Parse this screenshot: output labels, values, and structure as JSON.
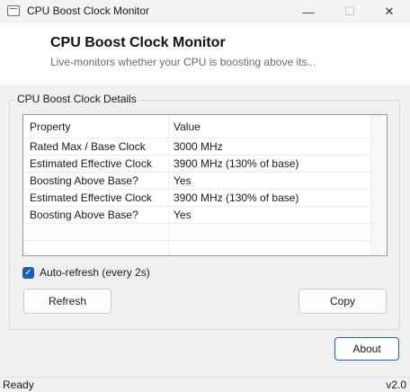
{
  "window": {
    "title": "CPU Boost Clock Monitor",
    "minimize_glyph": "—",
    "maximize_glyph": "☐",
    "close_glyph": "✕"
  },
  "header": {
    "title": "CPU Boost Clock Monitor",
    "subtitle": "Live-monitors whether your CPU is boosting above its..."
  },
  "group": {
    "label": "CPU Boost Clock Details"
  },
  "table": {
    "columns": [
      "Property",
      "Value"
    ],
    "rows": [
      [
        "Rated Max / Base Clock",
        "3000 MHz"
      ],
      [
        "Estimated Effective Clock",
        "3900 MHz (130% of base)"
      ],
      [
        "Boosting Above Base?",
        "Yes"
      ],
      [
        "Estimated Effective Clock",
        "3900 MHz (130% of base)"
      ],
      [
        "Boosting Above Base?",
        "Yes"
      ]
    ]
  },
  "auto_refresh": {
    "label": "Auto-refresh (every 2s)",
    "checked": true
  },
  "buttons": {
    "refresh": "Refresh",
    "copy": "Copy",
    "about": "About"
  },
  "status": {
    "left": "Ready",
    "right": "v2.0"
  },
  "colors": {
    "accent": "#1a5fb4"
  }
}
